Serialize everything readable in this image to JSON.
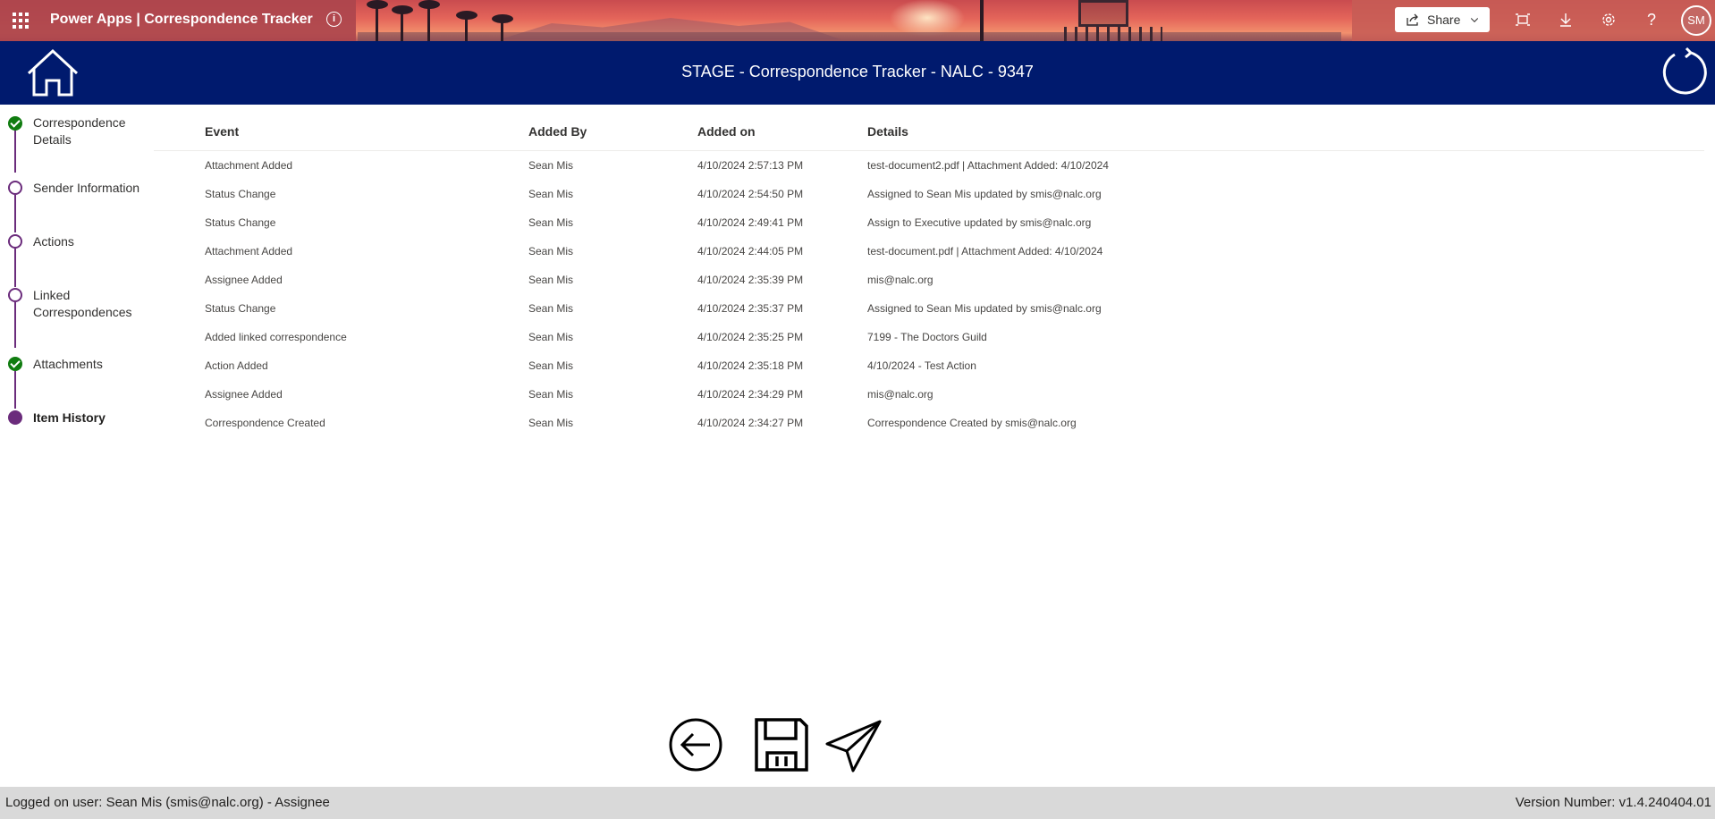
{
  "topbar": {
    "brand": "Power Apps  |  Correspondence Tracker",
    "share_label": "Share",
    "help_glyph": "?",
    "avatar_initials": "SM",
    "info_glyph": "i"
  },
  "header": {
    "title": "STAGE - Correspondence Tracker  - NALC - 9347",
    "background_color": "#001a6e"
  },
  "stepper": {
    "accent_color": "#6b2c7c",
    "complete_color": "#107c10",
    "steps": [
      {
        "label": "Correspondence Details",
        "state": "complete"
      },
      {
        "label": "Sender Information",
        "state": "open"
      },
      {
        "label": "Actions",
        "state": "open"
      },
      {
        "label": "Linked Correspondences",
        "state": "open"
      },
      {
        "label": "Attachments",
        "state": "complete"
      },
      {
        "label": "Item History",
        "state": "current"
      }
    ]
  },
  "history": {
    "columns": [
      "Event",
      "Added By",
      "Added on",
      "Details"
    ],
    "rows": [
      [
        "Attachment Added",
        "Sean Mis",
        "4/10/2024 2:57:13 PM",
        "test-document2.pdf | Attachment Added: 4/10/2024"
      ],
      [
        "Status Change",
        "Sean Mis",
        "4/10/2024 2:54:50 PM",
        "Assigned to Sean Mis updated by smis@nalc.org"
      ],
      [
        "Status Change",
        "Sean Mis",
        "4/10/2024 2:49:41 PM",
        "Assign to Executive updated by smis@nalc.org"
      ],
      [
        "Attachment Added",
        "Sean Mis",
        "4/10/2024 2:44:05 PM",
        "test-document.pdf | Attachment Added: 4/10/2024"
      ],
      [
        "Assignee Added",
        "Sean Mis",
        "4/10/2024 2:35:39 PM",
        "mis@nalc.org"
      ],
      [
        "Status Change",
        "Sean Mis",
        "4/10/2024 2:35:37 PM",
        "Assigned to Sean Mis updated by smis@nalc.org"
      ],
      [
        "Added linked correspondence",
        "Sean Mis",
        "4/10/2024 2:35:25 PM",
        "7199 - The Doctors Guild"
      ],
      [
        "Action Added",
        "Sean Mis",
        "4/10/2024 2:35:18 PM",
        "4/10/2024 - Test Action"
      ],
      [
        "Assignee Added",
        "Sean Mis",
        "4/10/2024 2:34:29 PM",
        "mis@nalc.org"
      ],
      [
        "Correspondence Created",
        "Sean Mis",
        "4/10/2024 2:34:27 PM",
        "Correspondence Created by smis@nalc.org"
      ]
    ]
  },
  "actions": {
    "icons": [
      "back-arrow-icon",
      "save-disk-icon",
      "send-plane-icon"
    ]
  },
  "footer": {
    "logged_on": "Logged on user: Sean Mis (smis@nalc.org) - Assignee",
    "version": "Version Number: v1.4.240404.01"
  }
}
